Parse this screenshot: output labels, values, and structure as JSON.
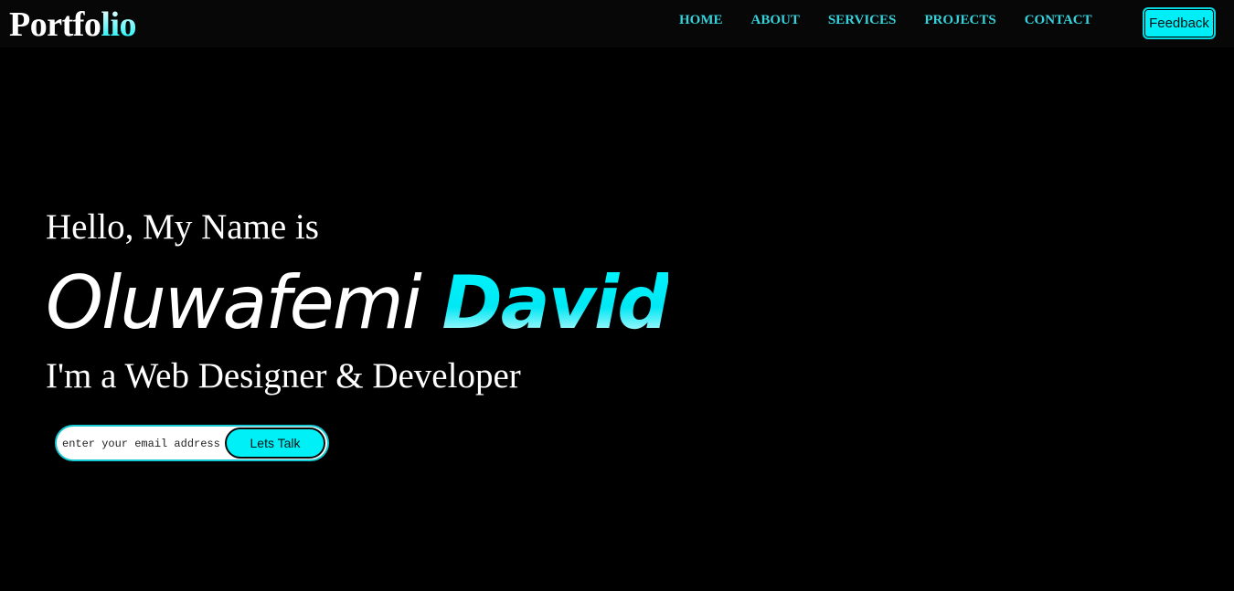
{
  "navbar": {
    "logo": {
      "part1": "Portfo",
      "part2": "lio"
    },
    "links": [
      {
        "label": "HOME"
      },
      {
        "label": "ABOUT"
      },
      {
        "label": "SERVICES"
      },
      {
        "label": "PROJECTS"
      },
      {
        "label": "CONTACT"
      }
    ],
    "feedback_label": "Feedback"
  },
  "hero": {
    "greeting": "Hello, My Name is",
    "name_first": "Oluwafemi",
    "name_last": "David",
    "role": "I'm a Web Designer & Developer",
    "email_placeholder": "enter your email address",
    "cta_label": "Lets Talk"
  },
  "colors": {
    "background": "#000000",
    "accent": "#00f0f8",
    "nav_link": "#36d2dc"
  }
}
